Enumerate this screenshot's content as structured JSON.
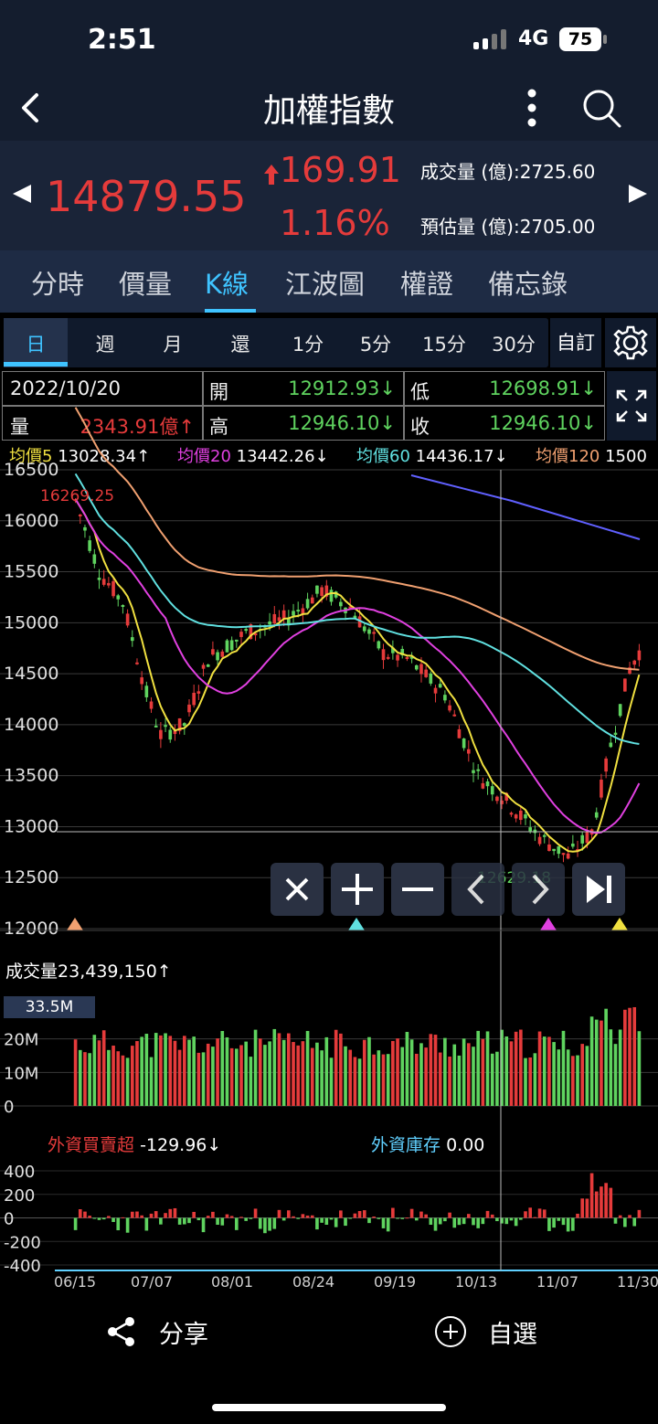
{
  "status": {
    "time": "2:51",
    "network": "4G",
    "battery": "75"
  },
  "header": {
    "title": "加權指數"
  },
  "quote": {
    "price": "14879.55",
    "change": "169.91",
    "change_pct": "1.16%",
    "volume_label": "成交量 (億):",
    "volume_value": "2725.60",
    "est_label": "預估量 (億):",
    "est_value": "2705.00"
  },
  "tabs": [
    "分時",
    "價量",
    "K線",
    "江波圖",
    "權證",
    "備忘錄"
  ],
  "active_tab": "K線",
  "periods": [
    "日",
    "週",
    "月",
    "還",
    "1分",
    "5分",
    "15分",
    "30分"
  ],
  "custom_label": "自訂",
  "ohlc": {
    "date": "2022/10/20",
    "open_label": "開",
    "open": "12912.93↓",
    "low_label": "低",
    "low": "12698.91↓",
    "vol_label": "量",
    "vol": "2343.91億↑",
    "high_label": "高",
    "high": "12946.10↓",
    "close_label": "收",
    "close": "12946.10↓"
  },
  "ma": [
    {
      "label": "均價5",
      "value": "13028.34↑",
      "color": "#f0e040"
    },
    {
      "label": "均價20",
      "value": "13442.26↓",
      "color": "#e040e0"
    },
    {
      "label": "均價60",
      "value": "14436.17↓",
      "color": "#60e0e0"
    },
    {
      "label": "均價120",
      "value": "1500",
      "color": "#f0a070"
    }
  ],
  "price_axis": [
    "16500",
    "16000",
    "15500",
    "15000",
    "14500",
    "14000",
    "13500",
    "13000",
    "12500",
    "12000"
  ],
  "max_label": "16269.25",
  "min_label": "12629.18",
  "controls": [
    "close-icon",
    "zoom-in-icon",
    "zoom-out-icon",
    "prev-icon",
    "next-icon",
    "last-icon"
  ],
  "volume": {
    "label": "成交量",
    "value": "23,439,150↑",
    "axis": [
      "20M",
      "10M",
      "0"
    ],
    "tag": "33.5M"
  },
  "foreign": {
    "label": "外資買賣超",
    "value": "-129.96↓",
    "stock_label": "外資庫存",
    "stock_value": "0.00",
    "axis": [
      "400",
      "200",
      "0",
      "-200",
      "-400"
    ]
  },
  "dates": [
    "06/15",
    "07/07",
    "08/01",
    "08/24",
    "09/19",
    "10/13",
    "11/07",
    "11/30"
  ],
  "bottom": {
    "share": "分享",
    "watch": "自選"
  },
  "colors": {
    "up": "#e53b3b",
    "down": "#5fd35f",
    "bg": "#000000",
    "header": "#141d2e"
  }
}
